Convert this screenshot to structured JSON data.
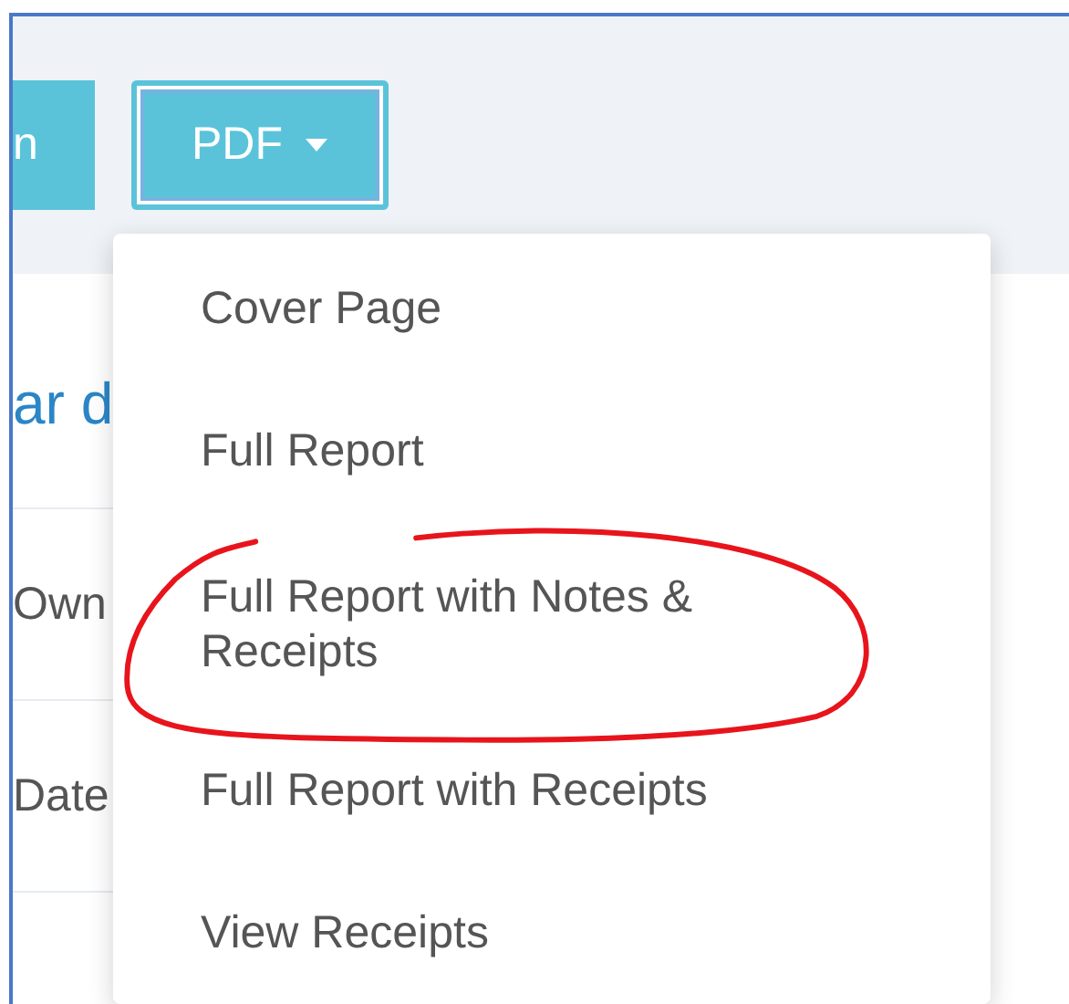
{
  "toolbar": {
    "buttons": [
      {
        "label": "n",
        "kind": "plain"
      },
      {
        "label": "PDF",
        "kind": "dropdown",
        "focused": true
      }
    ]
  },
  "page": {
    "heading": "ar d",
    "fields": [
      {
        "label": "Own"
      },
      {
        "label": "Date"
      }
    ]
  },
  "menu": {
    "items": [
      {
        "label": "Cover Page"
      },
      {
        "label": "Full Report"
      },
      {
        "label": "Full Report with Notes & Receipts",
        "annotated": true
      },
      {
        "label": "Full Report with Receipts"
      },
      {
        "label": "View Receipts"
      }
    ]
  }
}
